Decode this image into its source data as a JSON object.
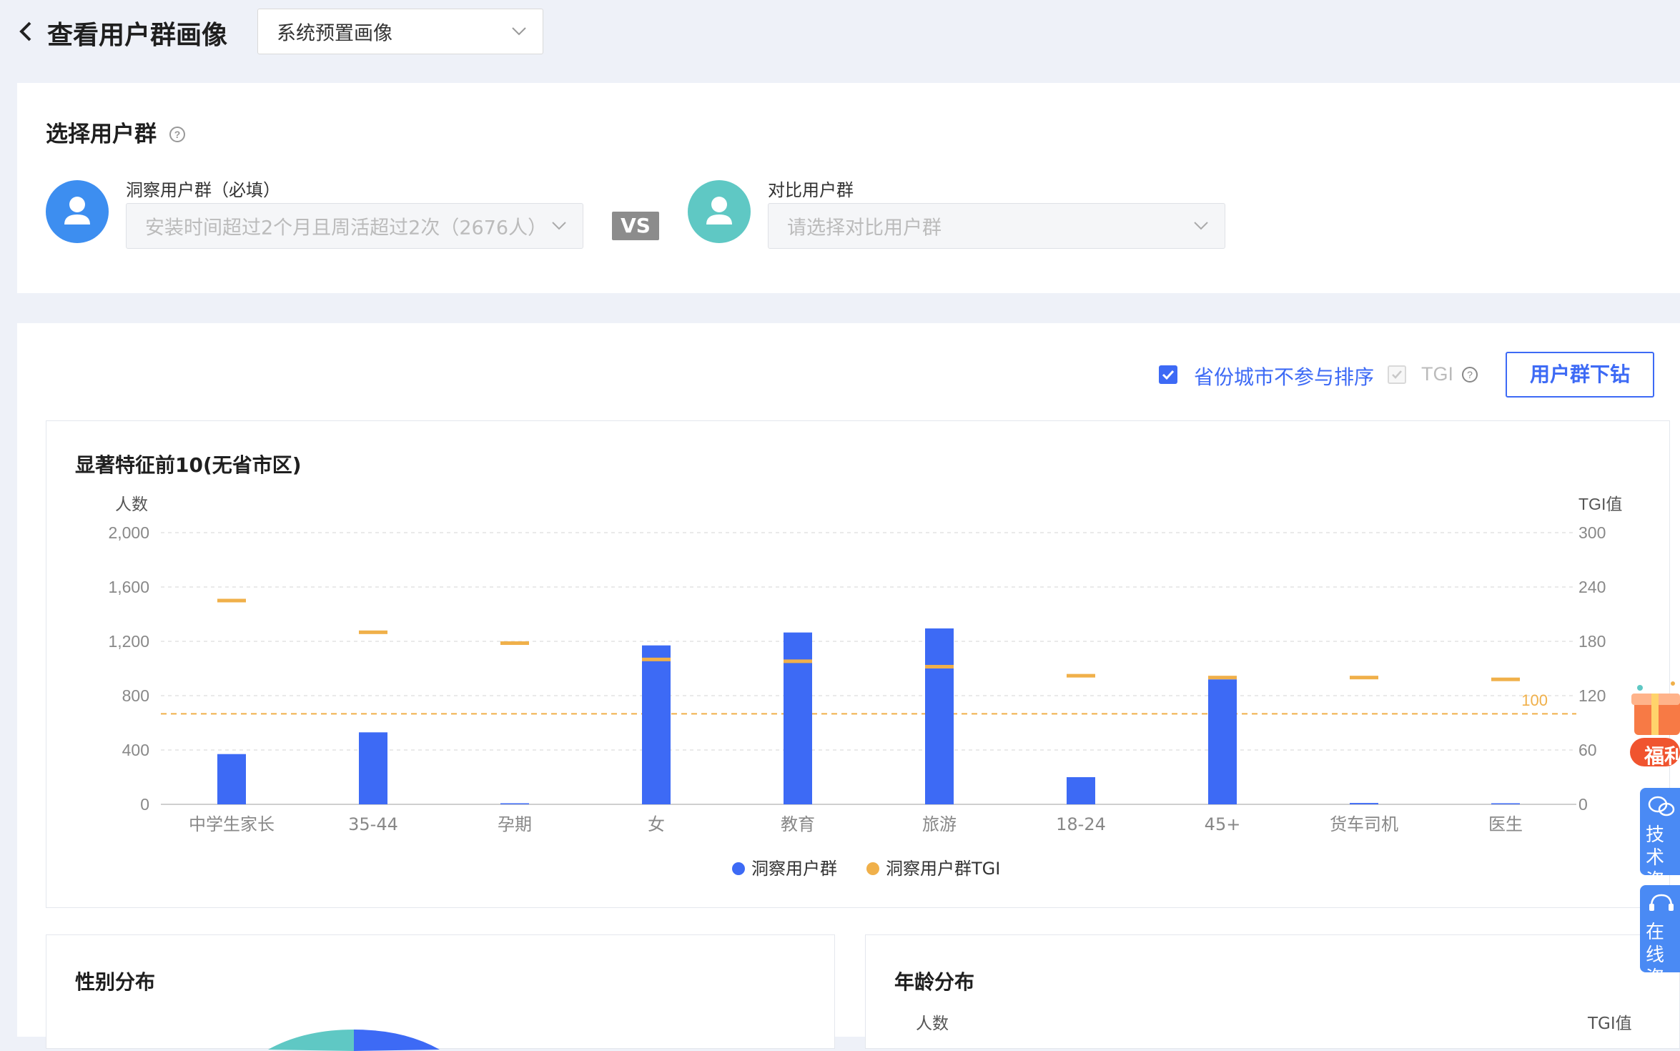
{
  "header": {
    "title": "查看用户群画像",
    "preset_dropdown": "系统预置画像"
  },
  "select_group": {
    "title": "选择用户群",
    "insight_label": "洞察用户群（必填）",
    "insight_value": "安装时间超过2个月且周活超过2次（2676人）",
    "vs": "VS",
    "compare_label": "对比用户群",
    "compare_placeholder": "请选择对比用户群"
  },
  "toolbar": {
    "exclude_region_label": "省份城市不参与排序",
    "tgi_label": "TGI",
    "drill_button": "用户群下钻"
  },
  "colors": {
    "accent": "#3d6af5",
    "tgi": "#f0b04a",
    "avatar_blue": "#3d8ef0",
    "avatar_teal": "#5fc8c4"
  },
  "top_features": {
    "title": "显著特征前10(无省市区)",
    "y_left_title": "人数",
    "y_right_title": "TGI值",
    "baseline_label": "100",
    "legend_bar": "洞察用户群",
    "legend_tgi": "洞察用户群TGI",
    "y_left_ticks": [
      "2,000",
      "1,600",
      "1,200",
      "800",
      "400",
      "0"
    ],
    "y_right_ticks": [
      "300",
      "240",
      "180",
      "120",
      "60",
      "0"
    ]
  },
  "chart_data": {
    "type": "bar",
    "title": "显著特征前10(无省市区)",
    "xlabel": "",
    "ylabel": "人数",
    "y2label": "TGI值",
    "ylim": [
      0,
      2000
    ],
    "y2lim": [
      0,
      300
    ],
    "categories": [
      "中学生家长",
      "35-44",
      "孕期",
      "女",
      "教育",
      "旅游",
      "18-24",
      "45+",
      "货车司机",
      "医生"
    ],
    "series": [
      {
        "name": "洞察用户群",
        "type": "bar",
        "axis": "left",
        "values": [
          370,
          530,
          5,
          1170,
          1265,
          1295,
          200,
          920,
          10,
          5
        ]
      },
      {
        "name": "洞察用户群TGI",
        "type": "marker",
        "axis": "right",
        "values": [
          225,
          190,
          178,
          160,
          158,
          152,
          142,
          140,
          140,
          138
        ]
      }
    ],
    "reference_line": {
      "axis": "right",
      "value": 100,
      "label": "100"
    },
    "grid": true,
    "legend": "bottom-center"
  },
  "gender": {
    "title": "性别分布"
  },
  "age": {
    "title": "年龄分布",
    "y_left_title": "人数",
    "y_right_title": "TGI值"
  },
  "float_buttons": {
    "welfare": "福利",
    "tech_consult": "技术咨询",
    "online_consult": "在线咨询"
  }
}
